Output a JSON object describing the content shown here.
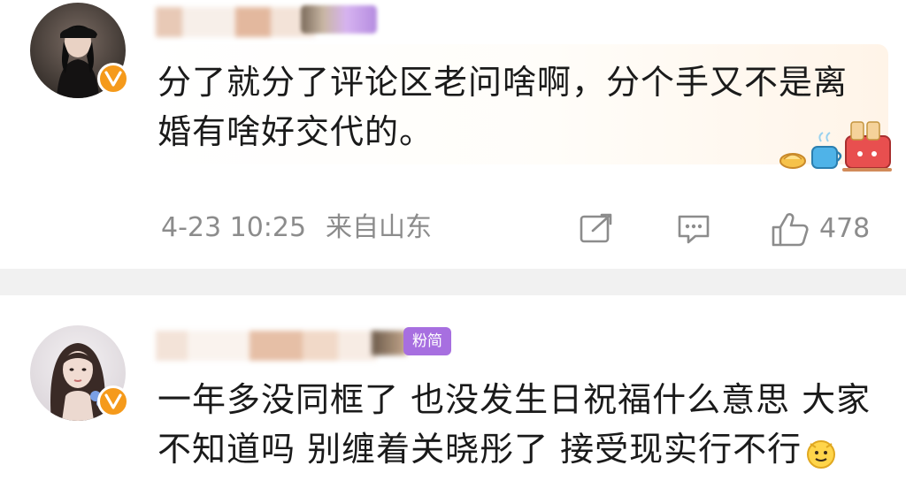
{
  "comments": [
    {
      "content": "分了就分了评论区老问啥啊，分个手又不是离婚有啥好交代的。",
      "timestamp": "4-23 10:25",
      "location": "来自山东",
      "likes": "478",
      "icons": [
        "verified-badge-icon",
        "share-icon",
        "comment-icon",
        "thumbs-up-icon"
      ]
    },
    {
      "content": "一年多没同框了 也没发生日祝福什么意思 大家不知道吗 别缠着关晓彤了 接受现实行不行",
      "tag": "粉简",
      "icons": [
        "verified-badge-icon",
        "emoji-icon"
      ]
    }
  ],
  "colors": {
    "verified": "#f59a1b",
    "meta_text": "#8c8c8c",
    "divider": "#f1f1f1",
    "tag_purple": "#a76fe0"
  }
}
